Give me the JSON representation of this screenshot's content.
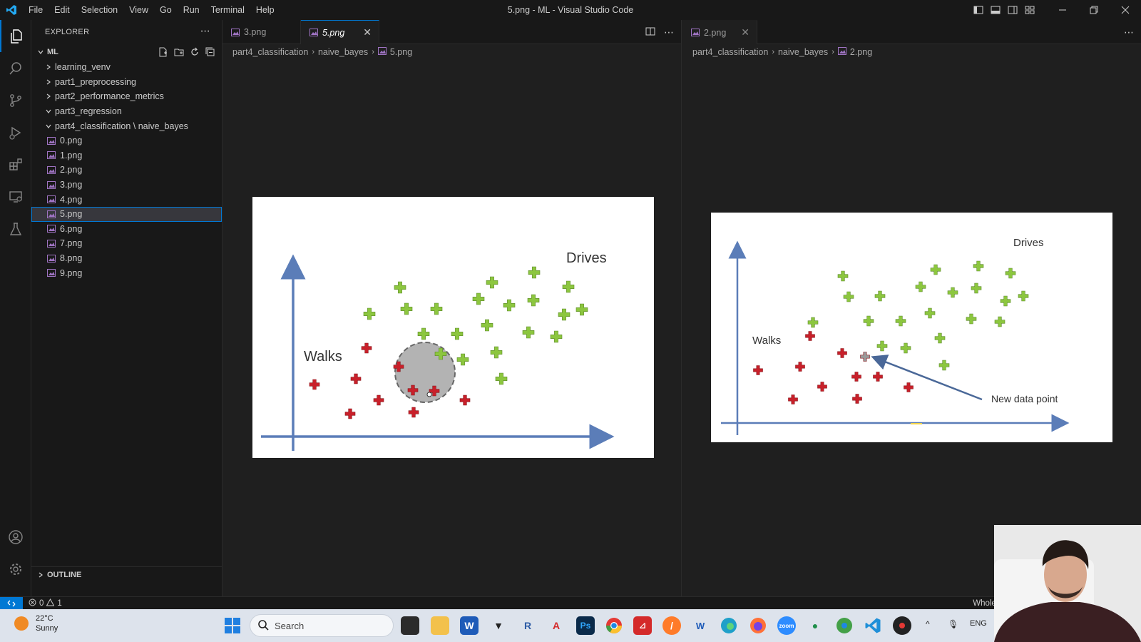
{
  "window": {
    "title": "5.png - ML - Visual Studio Code",
    "menu": [
      "File",
      "Edit",
      "Selection",
      "View",
      "Go",
      "Run",
      "Terminal",
      "Help"
    ]
  },
  "explorer": {
    "title": "EXPLORER",
    "root": "ML",
    "folders": [
      "learning_venv",
      "part1_preprocessing",
      "part2_performance_metrics",
      "part3_regression"
    ],
    "open_folder": "part4_classification \\ naive_bayes",
    "files": [
      "0.png",
      "1.png",
      "2.png",
      "3.png",
      "4.png",
      "5.png",
      "6.png",
      "7.png",
      "8.png",
      "9.png"
    ],
    "selected_file": "5.png",
    "outline": "OUTLINE"
  },
  "editor1": {
    "tabs": [
      {
        "label": "3.png"
      },
      {
        "label": "5.png"
      }
    ],
    "breadcrumb": [
      "part4_classification",
      "naive_bayes",
      "5.png"
    ]
  },
  "editor2": {
    "tabs": [
      {
        "label": "2.png"
      }
    ],
    "breadcrumb": [
      "part4_classification",
      "naive_bayes",
      "2.png"
    ]
  },
  "slide1": {
    "drives_label": "Drives",
    "walks_label": "Walks"
  },
  "slide2": {
    "drives_label": "Drives",
    "walks_label": "Walks",
    "annotation": "New data point"
  },
  "statusbar": {
    "errors": "0",
    "warnings": "1",
    "right_text": "Whole Image"
  },
  "taskbar": {
    "temperature": "22°C",
    "condition": "Sunny",
    "search_placeholder": "Search",
    "tray_lang": "ENG"
  },
  "colors": {
    "accent": "#0078d4",
    "red_point": "#c8202a",
    "green_point": "#8cc63f",
    "axis": "#5b7db8"
  }
}
